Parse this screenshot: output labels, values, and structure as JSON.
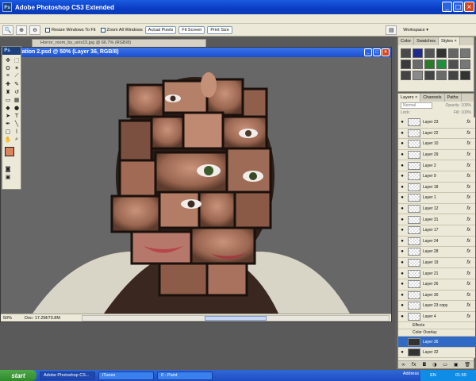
{
  "app": {
    "title": "Adobe Photoshop CS3 Extended",
    "ps_badge": "Ps"
  },
  "options_bar": {
    "resize_windows": "Resize Windows To Fit",
    "zoom_all_windows": "Zoom All Windows",
    "actual_pixels": "Actual Pixels",
    "fit_screen": "Fit Screen",
    "print_size": "Print Size",
    "workspace": "Workspace ▾"
  },
  "background_doc": {
    "title": "Horror_room_by_unix15.jpg @ 66.7% (RGB/8)"
  },
  "document": {
    "title": "anipulation 2.psd @ 50% (Layer 36, RGB/8)",
    "zoom": "50%",
    "doc_size": "Doc: 17.2M/70.8M"
  },
  "toolbox": {
    "head": "Ps",
    "fg_color": "#d9845d",
    "bg_color": "#eed5c4"
  },
  "swatches_panel": {
    "tabs": [
      "Color",
      "Swatches",
      "Styles ×"
    ],
    "styles": [
      "#4a4a4a",
      "#1f2a8f",
      "#555",
      "#333",
      "#666",
      "#777",
      "#3b3b3b",
      "#6a6a6a",
      "#2a7a2a",
      "#1e8f3a",
      "#505050",
      "#777",
      "#444",
      "#8a8a8a",
      "#444",
      "#6b6b6b",
      "#444",
      "#333"
    ]
  },
  "layers_panel": {
    "tabs": [
      "Layers ×",
      "Channels",
      "Paths"
    ],
    "blend_mode": "Normal",
    "opacity_label": "Opacity: 100%",
    "lock_label": "Lock:",
    "fill_label": "Fill: 100%",
    "rows": [
      {
        "name": "Layer 23",
        "fx": "fx",
        "dark": false,
        "selected": false
      },
      {
        "name": "Layer 22",
        "fx": "fx",
        "dark": false,
        "selected": false
      },
      {
        "name": "Layer 10",
        "fx": "fx",
        "dark": false,
        "selected": false
      },
      {
        "name": "Layer 29",
        "fx": "fx",
        "dark": false,
        "selected": false
      },
      {
        "name": "Layer 2",
        "fx": "fx",
        "dark": false,
        "selected": false
      },
      {
        "name": "Layer 9",
        "fx": "fx",
        "dark": false,
        "selected": false
      },
      {
        "name": "Layer 18",
        "fx": "fx",
        "dark": false,
        "selected": false
      },
      {
        "name": "Layer 1",
        "fx": "fx",
        "dark": false,
        "selected": false
      },
      {
        "name": "Layer 12",
        "fx": "fx",
        "dark": false,
        "selected": false
      },
      {
        "name": "Layer 31",
        "fx": "fx",
        "dark": false,
        "selected": false
      },
      {
        "name": "Layer 17",
        "fx": "fx",
        "dark": false,
        "selected": false
      },
      {
        "name": "Layer 24",
        "fx": "fx",
        "dark": false,
        "selected": false
      },
      {
        "name": "Layer 28",
        "fx": "fx",
        "dark": false,
        "selected": false
      },
      {
        "name": "Layer 19",
        "fx": "fx",
        "dark": false,
        "selected": false
      },
      {
        "name": "Layer 21",
        "fx": "fx",
        "dark": false,
        "selected": false
      },
      {
        "name": "Layer 26",
        "fx": "fx",
        "dark": false,
        "selected": false
      },
      {
        "name": "Layer 30",
        "fx": "fx",
        "dark": false,
        "selected": false
      },
      {
        "name": "Layer 23 copy",
        "fx": "fx",
        "dark": false,
        "selected": false
      },
      {
        "name": "Layer 4",
        "fx": "fx",
        "dark": false,
        "selected": false
      }
    ],
    "effects_label": "Effects",
    "color_overlay_label": "Color Overlay",
    "selected_layer": "Layer 36",
    "last_layer": "Layer 32"
  },
  "taskbar": {
    "start": "start",
    "tasks": [
      "Adobe Photoshop CS...",
      "iTunes",
      "0 - Paint"
    ],
    "address": "Address",
    "lang": "EN",
    "clock": "01:59"
  }
}
